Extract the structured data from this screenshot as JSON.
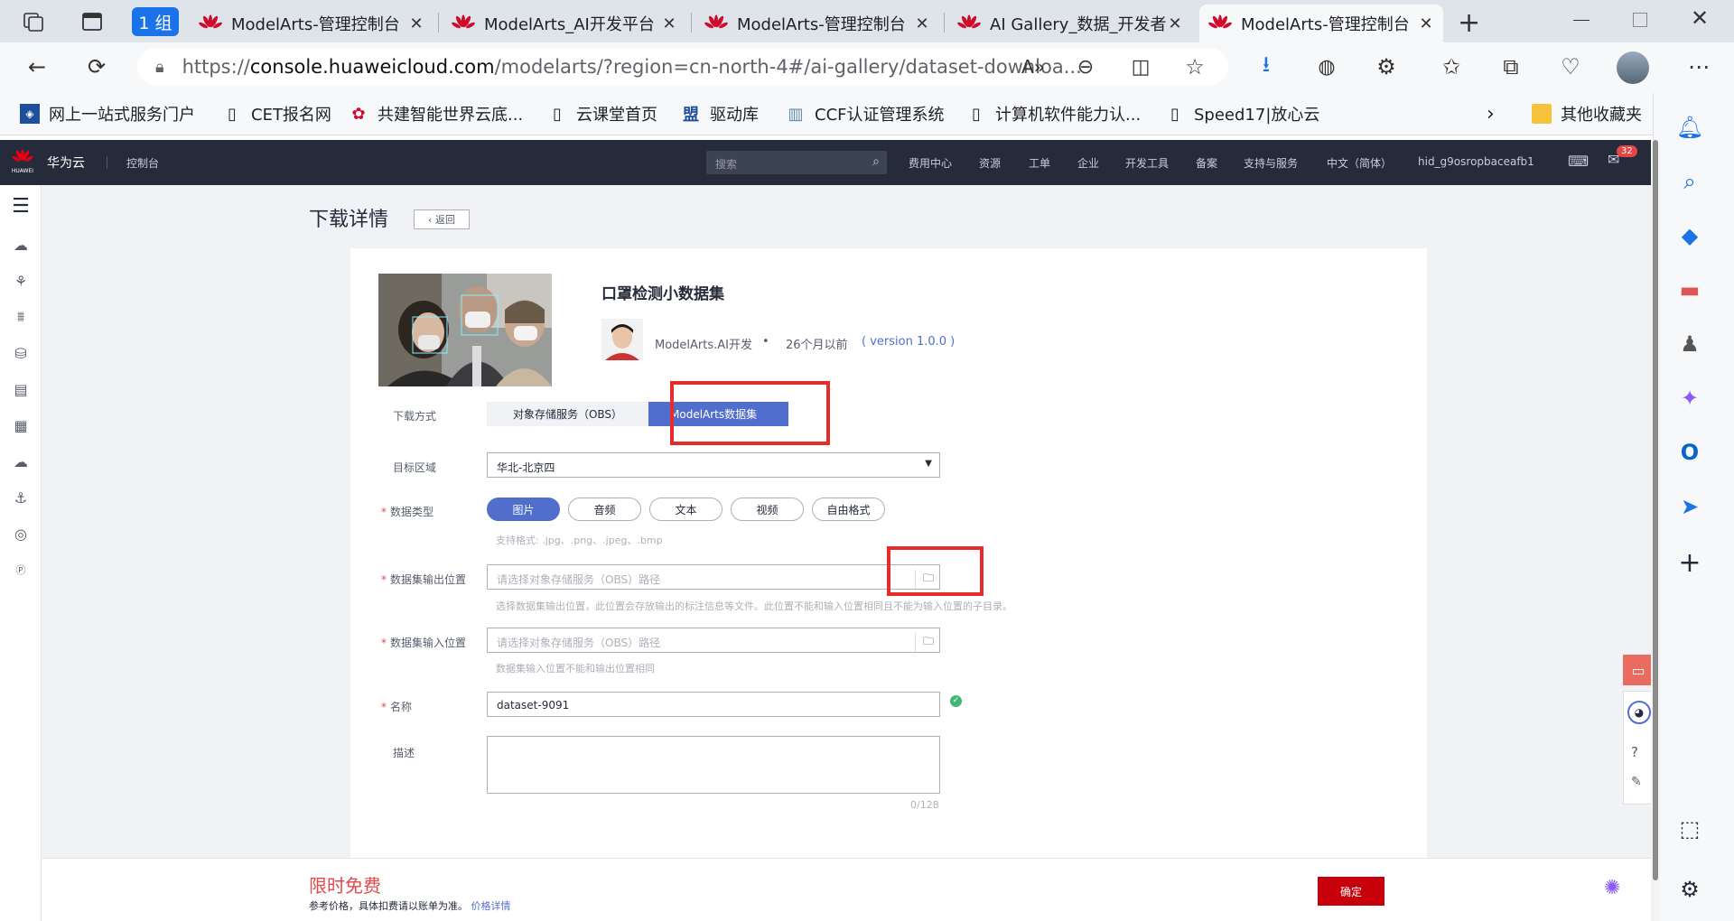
{
  "browser": {
    "tab_group": "1 组",
    "tabs": [
      {
        "title": "ModelArts-管理控制台"
      },
      {
        "title": "ModelArts_AI开发平台"
      },
      {
        "title": "ModelArts-管理控制台"
      },
      {
        "title": "AI Gallery_数据_开发者"
      },
      {
        "title": "ModelArts-管理控制台"
      }
    ],
    "url_prefix": "https://",
    "url_domain": "console.huaweicloud.com",
    "url_path": "/modelarts/?region=cn-north-4#/ai-gallery/dataset-downloa...",
    "favorites": [
      "网上一站式服务门户",
      "CET报名网",
      "共建智能世界云底...",
      "云课堂首页",
      "驱动库",
      "CCF认证管理系统",
      "计算机软件能力认...",
      "Speed17|放心云"
    ],
    "other_favorites": "其他收藏夹"
  },
  "header": {
    "brand": "华为云",
    "brand_badge": "HUAWEI",
    "console": "控制台",
    "search_placeholder": "搜索",
    "nav": [
      "费用中心",
      "资源",
      "工单",
      "企业",
      "开发工具",
      "备案",
      "支持与服务",
      "中文（简体）",
      "hid_g9osropbaceafb1"
    ],
    "msg_count": "32"
  },
  "page": {
    "title": "下载详情",
    "back": "返回"
  },
  "dataset": {
    "name": "口罩检测小数据集",
    "author": "ModelArts.AI开发",
    "time": "26个月以前",
    "version": "( version 1.0.0 )"
  },
  "form": {
    "download_method_label": "下载方式",
    "method_options": [
      "对象存储服务（OBS）",
      "ModelArts数据集"
    ],
    "region_label": "目标区域",
    "region_value": "华北-北京四",
    "data_type_label": "数据类型",
    "data_types": [
      "图片",
      "音频",
      "文本",
      "视频",
      "自由格式"
    ],
    "formats_hint": "支持格式: .jpg、.png、.jpeg、.bmp",
    "output_label": "数据集输出位置",
    "output_placeholder": "请选择对象存储服务（OBS）路径",
    "output_hint": "选择数据集输出位置，此位置会存放输出的标注信息等文件。此位置不能和输入位置相同且不能为输入位置的子目录。",
    "input_label": "数据集输入位置",
    "input_placeholder": "请选择对象存储服务（OBS）路径",
    "input_hint": "数据集输入位置不能和输出位置相同",
    "name_label": "名称",
    "name_value": "dataset-9091",
    "desc_label": "描述",
    "desc_counter": "0/128"
  },
  "footer": {
    "promo": "限时免费",
    "note": "参考价格，具体扣费请以账单为准。",
    "price_link": "价格详情",
    "confirm": "确定"
  },
  "colors": {
    "accent": "#526ecc",
    "red": "#c7000b",
    "annotation": "#e82b2b"
  }
}
